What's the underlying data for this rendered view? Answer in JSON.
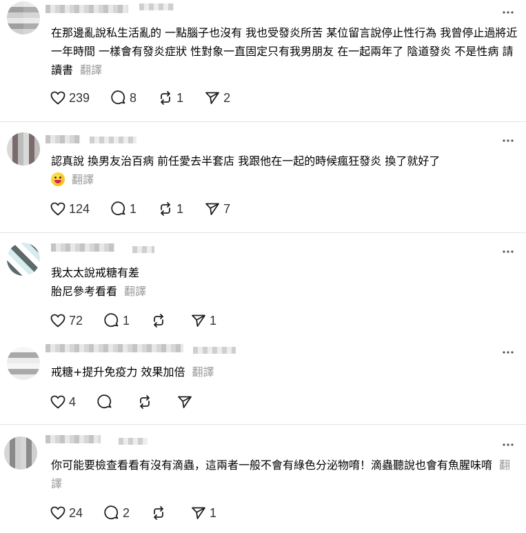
{
  "posts": [
    {
      "text": "在那邊亂說私生活亂的 一點腦子也沒有 我也受發炎所苦 某位留言說停止性行為 我曾停止過將近一年時間 一樣會有發炎症狀 性對象一直固定只有我男朋友 在一起兩年了 陰道發炎 不是性病 請讀書",
      "translate": "翻譯",
      "likes": "239",
      "comments": "8",
      "reposts": "1",
      "shares": "2"
    },
    {
      "text": "認真說 換男友治百病 前任愛去半套店 我跟他在一起的時候瘋狂發炎 換了就好了",
      "emoji": "grinning-face-emoji",
      "translate": "翻譯",
      "likes": "124",
      "comments": "1",
      "reposts": "1",
      "shares": "7"
    },
    {
      "line1": "我太太說戒糖有差",
      "line2": "胎尼參考看看",
      "translate": "翻譯",
      "likes": "72",
      "comments": "1",
      "reposts": "",
      "shares": "1"
    },
    {
      "text": "戒糖+提升免疫力 效果加倍",
      "translate": "翻譯",
      "likes": "4",
      "comments": "",
      "reposts": "",
      "shares": ""
    },
    {
      "text": "你可能要檢查看看有沒有滴蟲，這兩者一般不會有綠色分泌物唷！滴蟲聽說也會有魚腥味唷",
      "translate": "翻譯",
      "likes": "24",
      "comments": "2",
      "reposts": "",
      "shares": "1"
    }
  ],
  "icons": {
    "like": "heart-icon",
    "comment": "comment-bubble-icon",
    "repost": "repost-arrows-icon",
    "share": "send-paper-plane-icon",
    "more": "more-options-icon"
  },
  "colors": {
    "text": "#000000",
    "muted": "#999999",
    "icon": "#1f1f1f",
    "divider": "#e3e3e3"
  }
}
